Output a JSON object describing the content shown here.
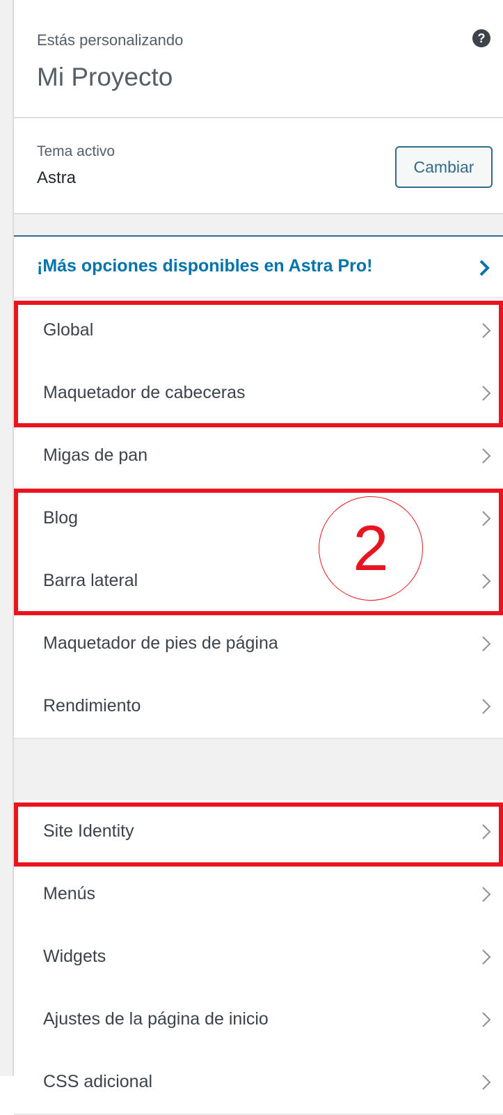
{
  "header": {
    "label": "Estás personalizando",
    "title": "Mi Proyecto",
    "help_icon": "question-circle-icon"
  },
  "theme": {
    "label": "Tema activo",
    "name": "Astra",
    "change_button": "Cambiar"
  },
  "promo": {
    "label": "¡Más opciones disponibles en Astra Pro!",
    "icon": "chevron-right-icon"
  },
  "sections": [
    {
      "label": "Global"
    },
    {
      "label": "Maquetador de cabeceras"
    },
    {
      "label": "Migas de pan"
    },
    {
      "label": "Blog"
    },
    {
      "label": "Barra lateral"
    },
    {
      "label": "Maquetador de pies de página"
    },
    {
      "label": "Rendimiento"
    },
    {
      "label": "Site Identity"
    },
    {
      "label": "Menús"
    },
    {
      "label": "Widgets"
    },
    {
      "label": "Ajustes de la página de inicio"
    },
    {
      "label": "CSS adicional"
    }
  ],
  "annotation": {
    "step_number": "2"
  },
  "colors": {
    "accent": "#0073aa",
    "button_border": "#2e6c8c",
    "highlight": "#e8141f"
  }
}
